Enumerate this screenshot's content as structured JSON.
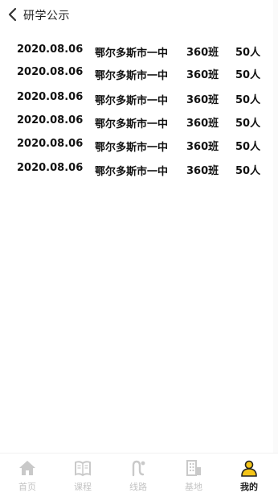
{
  "header": {
    "title": "研学公示"
  },
  "rows": [
    {
      "date": "2020.08.06",
      "school": "鄂尔多斯市一中",
      "class": "360班",
      "count": "50人"
    },
    {
      "date": "2020.08.06",
      "school": "鄂尔多斯市一中",
      "class": "360班",
      "count": "50人"
    },
    {
      "date": "2020.08.06",
      "school": "鄂尔多斯市一中",
      "class": "360班",
      "count": "50人"
    },
    {
      "date": "2020.08.06",
      "school": "鄂尔多斯市一中",
      "class": "360班",
      "count": "50人"
    },
    {
      "date": "2020.08.06",
      "school": "鄂尔多斯市一中",
      "class": "360班",
      "count": "50人"
    },
    {
      "date": "2020.08.06",
      "school": "鄂尔多斯市一中",
      "class": "360班",
      "count": "50人"
    }
  ],
  "tabbar": {
    "items": [
      {
        "label": "首页",
        "icon": "home-icon"
      },
      {
        "label": "课程",
        "icon": "book-icon"
      },
      {
        "label": "线路",
        "icon": "route-icon"
      },
      {
        "label": "基地",
        "icon": "building-icon"
      },
      {
        "label": "我的",
        "icon": "user-icon",
        "active": true
      }
    ]
  },
  "colors": {
    "active_icon": "#f5c518",
    "inactive": "#c4c4c4",
    "text": "#111111"
  }
}
